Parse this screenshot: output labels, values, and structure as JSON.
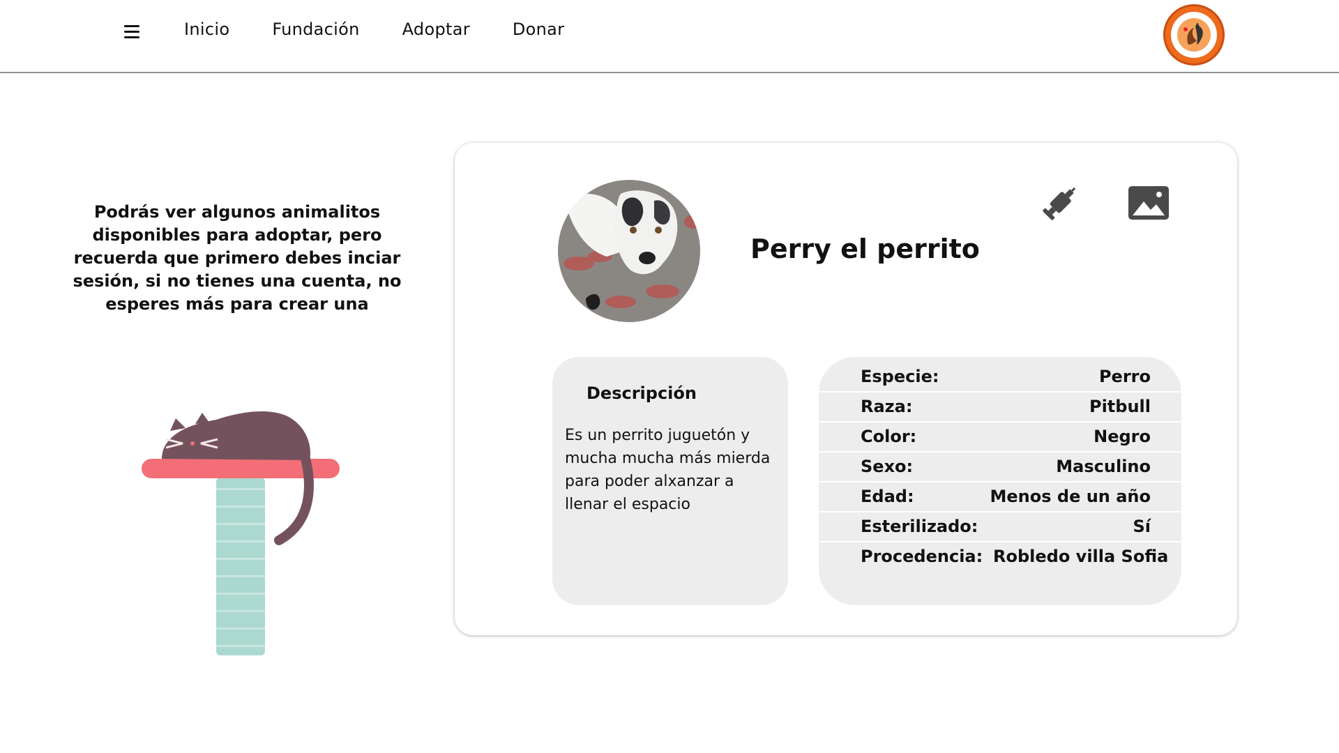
{
  "header": {
    "menu_icon": "hamburger-menu-icon",
    "nav": [
      {
        "label": "Inicio"
      },
      {
        "label": "Fundación"
      },
      {
        "label": "Adoptar"
      },
      {
        "label": "Donar"
      }
    ],
    "logo_icon": "foundation-logo",
    "logo_color": "#ee6a1c"
  },
  "intro": {
    "text": "Podrás ver algunos animalitos disponibles para adoptar, pero recuerda que primero debes inciar sesión, si no tienes una cuenta, no esperes más para crear una"
  },
  "pet": {
    "name": "Perry el perrito",
    "photo_icon": "dog-photo",
    "actions": {
      "vaccine_icon": "syringe-icon",
      "gallery_icon": "image-gallery-icon"
    },
    "description": {
      "title": "Descripción",
      "text": "Es un perrito juguetón y mucha mucha más mierda para poder alxanzar a llenar el espacio"
    },
    "attributes": [
      {
        "key": "Especie:",
        "value": "Perro"
      },
      {
        "key": "Raza:",
        "value": "Pitbull"
      },
      {
        "key": "Color:",
        "value": "Negro"
      },
      {
        "key": "Sexo:",
        "value": "Masculino"
      },
      {
        "key": "Edad:",
        "value": "Menos de un año"
      },
      {
        "key": "Esterilizado:",
        "value": "Sí"
      },
      {
        "key": "Procedencia:",
        "value": "Robledo villa Sofia"
      }
    ]
  },
  "colors": {
    "panel_bg": "#ededed",
    "cat_body": "#73525e",
    "cat_perch": "#f36e76",
    "cat_post": "#acd9cf"
  }
}
